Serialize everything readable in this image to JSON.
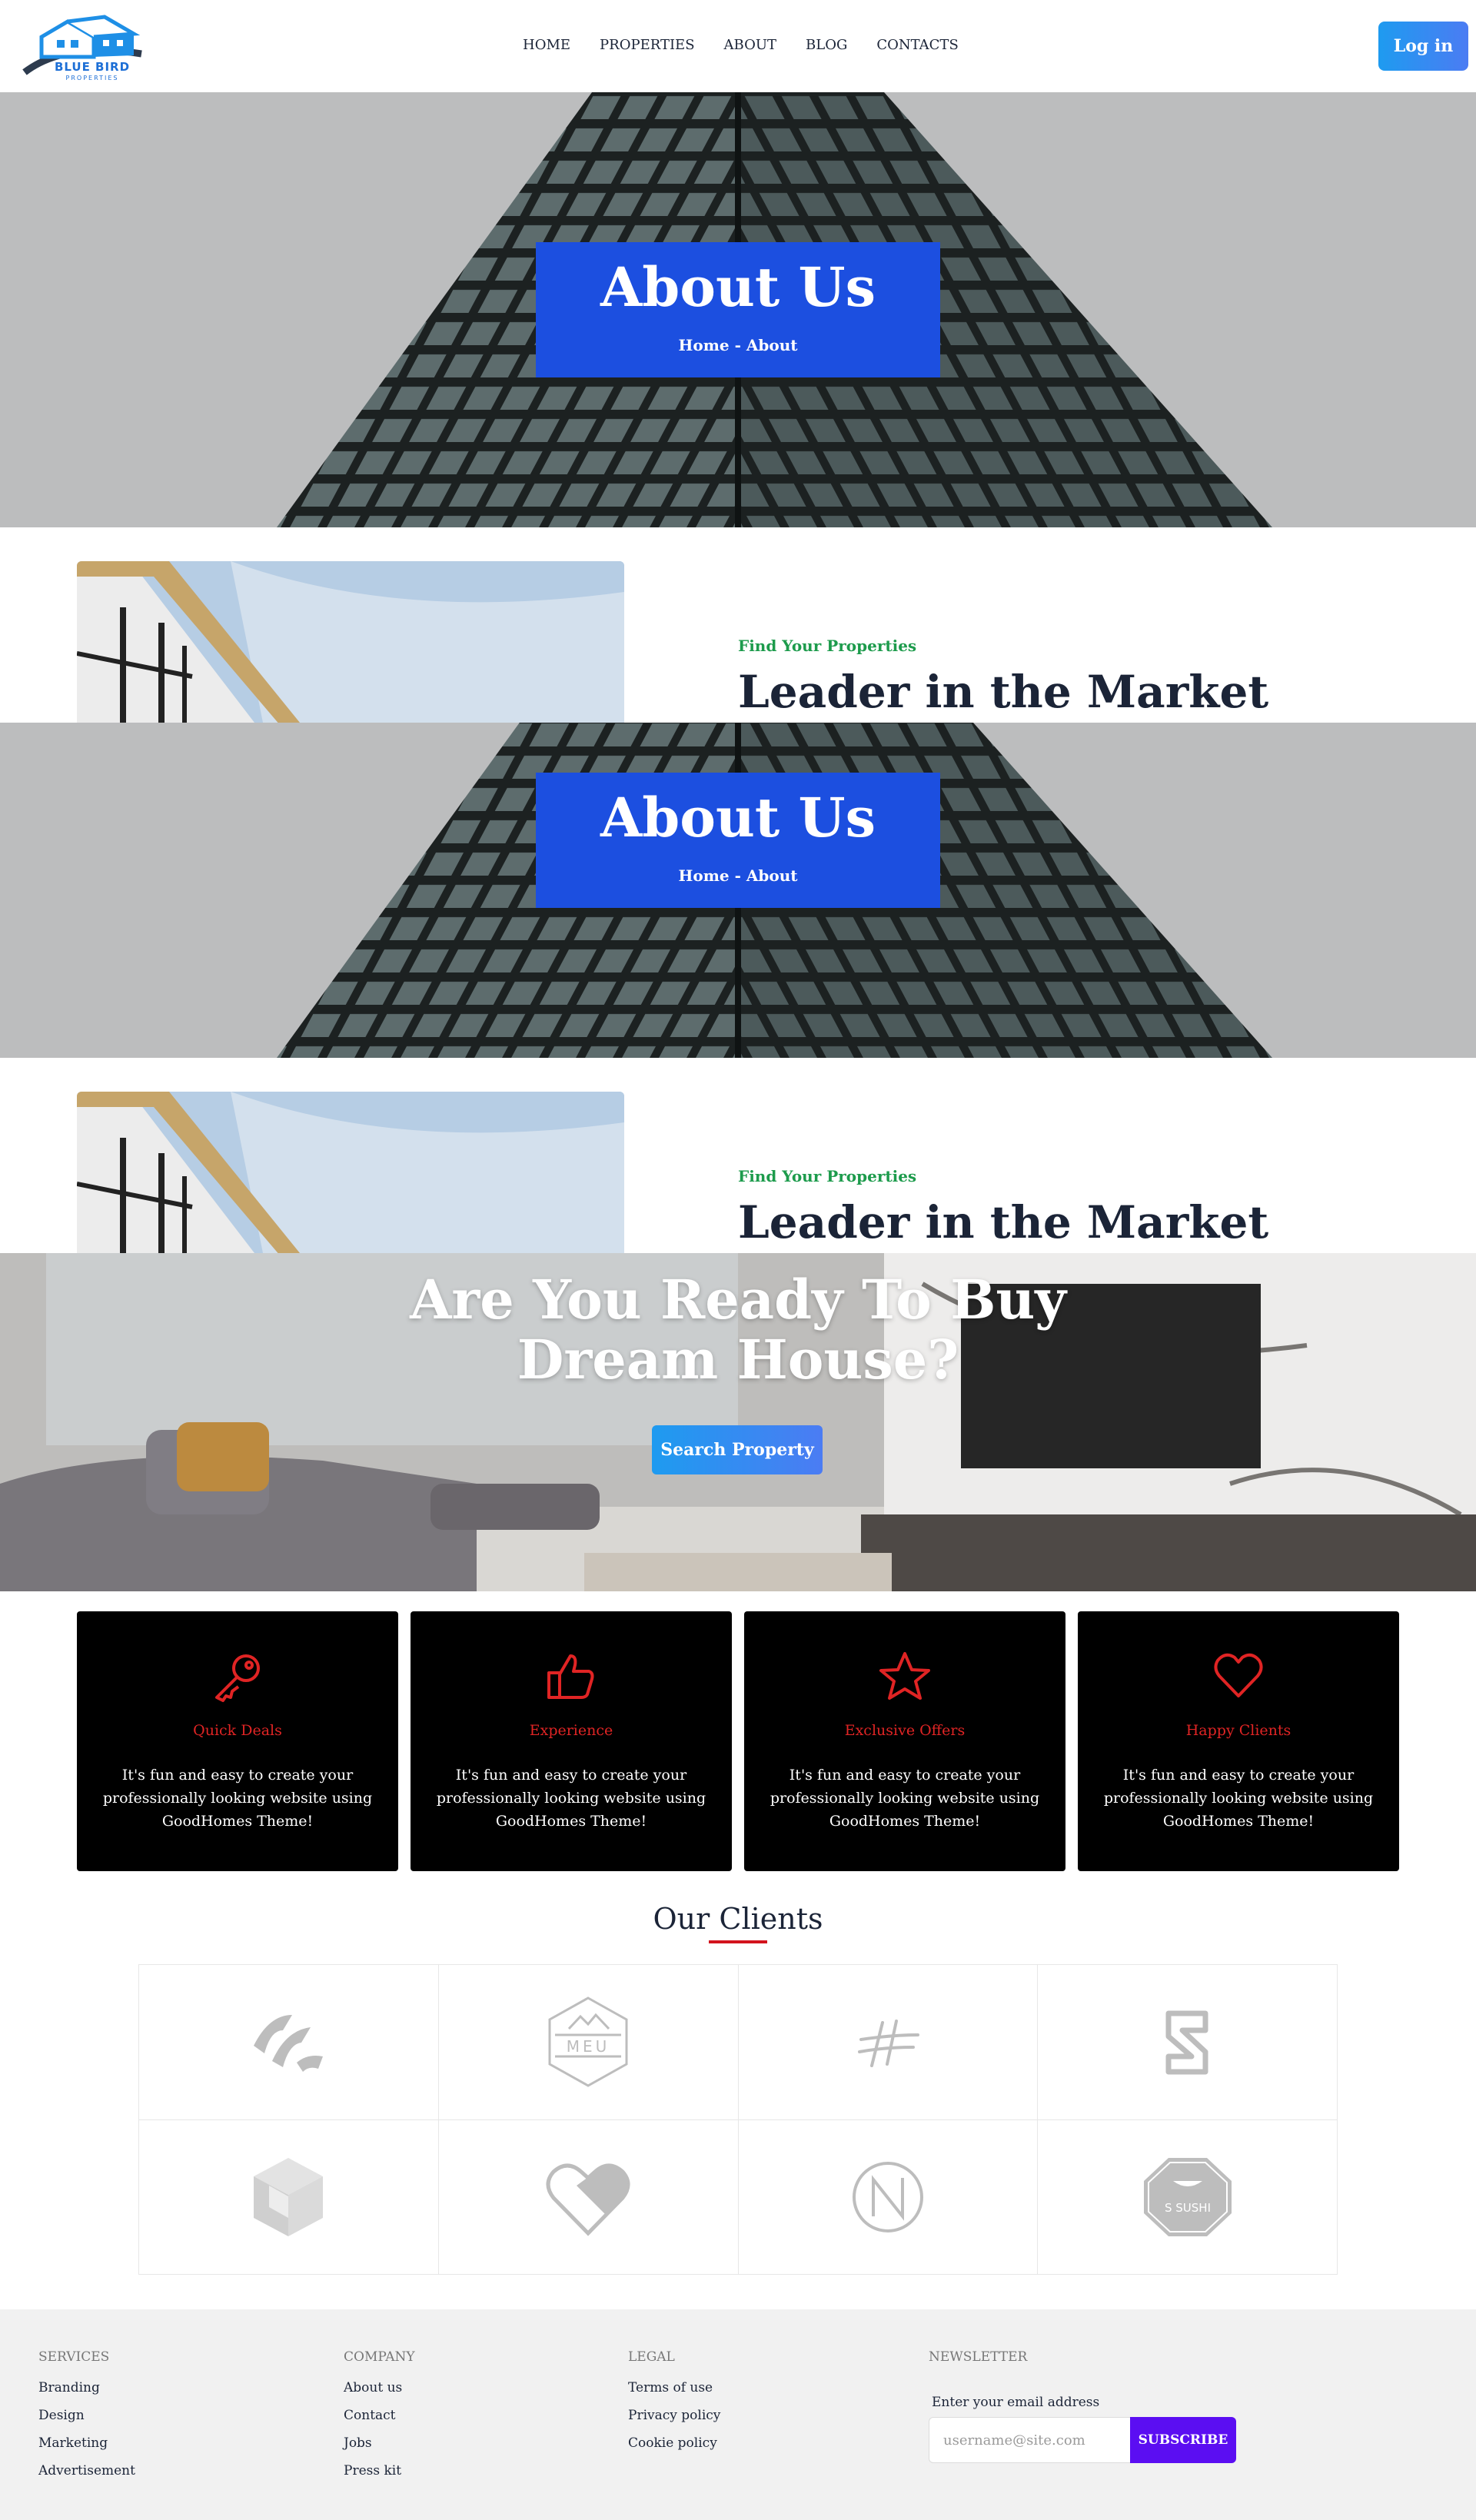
{
  "header": {
    "logo_text": "BLUE BIRD",
    "logo_subtext": "PROPERTIES",
    "nav": [
      "HOME",
      "PROPERTIES",
      "ABOUT",
      "BLOG",
      "CONTACTS"
    ],
    "login_label": "Log in"
  },
  "hero": {
    "title": "About Us",
    "breadcrumb": "Home - About"
  },
  "about": {
    "label": "Find Your Properties",
    "heading": "Leader in the Market"
  },
  "cta": {
    "title": "Are You Ready To Buy Dream House?",
    "button_label": "Search Property"
  },
  "features": [
    {
      "icon": "key-icon",
      "title": "Quick Deals",
      "text": "It's fun and easy to create your professionally looking website using GoodHomes Theme!"
    },
    {
      "icon": "thumbs-up-icon",
      "title": "Experience",
      "text": "It's fun and easy to create your professionally looking website using GoodHomes Theme!"
    },
    {
      "icon": "star-icon",
      "title": "Exclusive Offers",
      "text": "It's fun and easy to create your professionally looking website using GoodHomes Theme!"
    },
    {
      "icon": "heart-icon",
      "title": "Happy Clients",
      "text": "It's fun and easy to create your professionally looking website using GoodHomes Theme!"
    }
  ],
  "clients": {
    "title": "Our Clients",
    "logos": [
      {
        "icon": "swoosh-logo-icon",
        "text": ""
      },
      {
        "icon": "mountain-badge-logo-icon",
        "text": "MEU"
      },
      {
        "icon": "hashtag-logo-icon",
        "text": ""
      },
      {
        "icon": "shield-s-logo-icon",
        "text": ""
      },
      {
        "icon": "cube-logo-icon",
        "text": ""
      },
      {
        "icon": "heart-pill-logo-icon",
        "text": ""
      },
      {
        "icon": "circle-n-logo-icon",
        "text": ""
      },
      {
        "icon": "sushi-badge-logo-icon",
        "text": "S SUSHI"
      }
    ]
  },
  "footer": {
    "services": {
      "heading": "SERVICES",
      "links": [
        "Branding",
        "Design",
        "Marketing",
        "Advertisement"
      ]
    },
    "company": {
      "heading": "COMPANY",
      "links": [
        "About us",
        "Contact",
        "Jobs",
        "Press kit"
      ]
    },
    "legal": {
      "heading": "LEGAL",
      "links": [
        "Terms of use",
        "Privacy policy",
        "Cookie policy"
      ]
    },
    "newsletter": {
      "heading": "NEWSLETTER",
      "label": "Enter your email address",
      "placeholder": "username@site.com",
      "button_label": "SUBSCRIBE"
    }
  },
  "colors": {
    "brand_blue": "#1c4fe0",
    "accent_gradient_start": "#1e9bf0",
    "accent_gradient_end": "#4b7cf3",
    "feature_red": "#e02424",
    "label_green": "#1d9b4c",
    "subscribe_purple": "#5b0ef2"
  }
}
